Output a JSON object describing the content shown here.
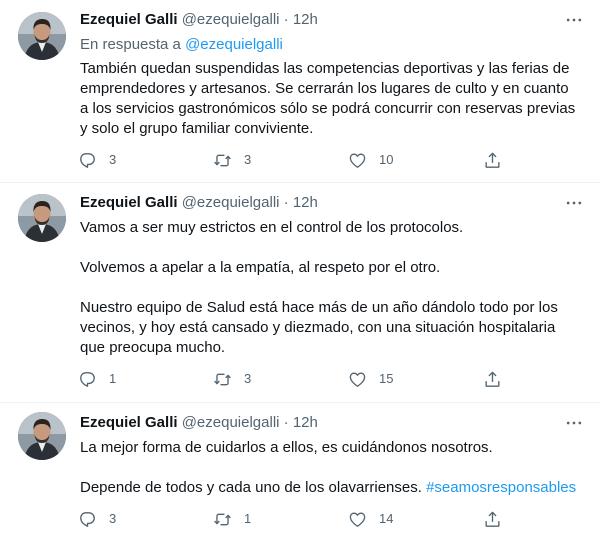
{
  "tweets": [
    {
      "name": "Ezequiel Galli",
      "handle": "@ezequielgalli",
      "sep": "·",
      "time": "12h",
      "reply_prefix": "En respuesta a ",
      "reply_handle": "@ezequielgalli",
      "paragraphs": [
        "También quedan suspendidas las competencias deportivas y las ferias de emprendedores y artesanos. Se cerrarán los lugares de culto y en cuanto a los servicios gastronómicos sólo se podrá concurrir con reservas previas y solo el grupo familiar conviviente."
      ],
      "replies": "3",
      "retweets": "3",
      "likes": "10"
    },
    {
      "name": "Ezequiel Galli",
      "handle": "@ezequielgalli",
      "sep": "·",
      "time": "12h",
      "paragraphs": [
        "Vamos a ser muy estrictos en el control de los protocolos.",
        "Volvemos a apelar a la empatía, al respeto por el otro.",
        "Nuestro equipo de Salud está hace más de un año dándolo todo por los vecinos, y hoy está cansado y diezmado, con una situación hospitalaria que preocupa mucho."
      ],
      "replies": "1",
      "retweets": "3",
      "likes": "15"
    },
    {
      "name": "Ezequiel Galli",
      "handle": "@ezequielgalli",
      "sep": "·",
      "time": "12h",
      "paragraphs": [
        "La mejor forma de cuidarlos a ellos, es cuidándonos nosotros.",
        "Depende de todos y cada uno de los olavarrienses. "
      ],
      "hashtag": "#seamosresponsables",
      "replies": "3",
      "retweets": "1",
      "likes": "14"
    }
  ],
  "icons": {
    "reply": "reply-icon",
    "retweet": "retweet-icon",
    "like": "heart-icon",
    "share": "share-icon",
    "more": "more-icon"
  },
  "colors": {
    "link": "#1d9bf0",
    "secondary": "#536471",
    "text": "#0f1419",
    "divider": "#eff3f4"
  }
}
